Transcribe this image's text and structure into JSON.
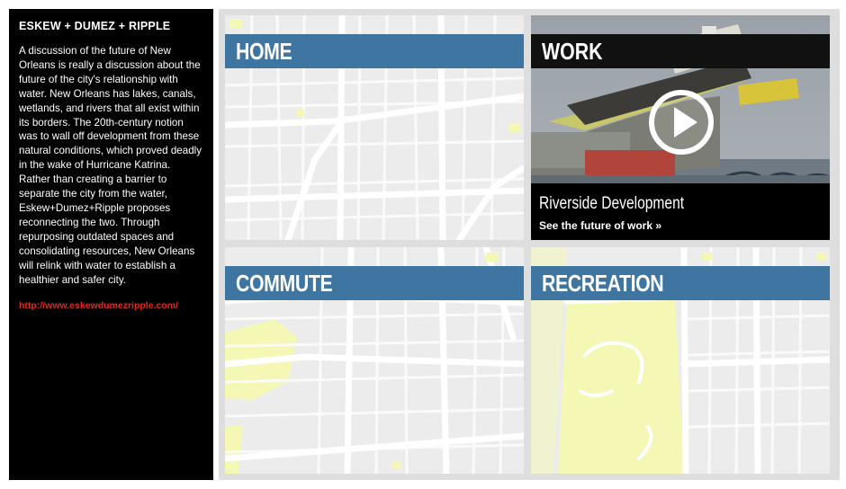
{
  "sidebar": {
    "title": "ESKEW + DUMEZ + RIPPLE",
    "description": "A discussion of the future of New Orleans is really a discussion about the future of the city's relationship with water. New Orleans has lakes, canals, wetlands, and rivers that all exist within its borders. The 20th-century notion was to wall off development from these natural conditions, which proved deadly in the wake of Hurricane Katrina. Rather than creating a barrier to separate the city from the water, Eskew+Dumez+Ripple proposes reconnecting the two. Through repurposing outdated spaces and consolidating resources, New Orleans will relink with water to establish a healthier and safer city.",
    "link": "http://www.eskewdumezripple.com/"
  },
  "tiles": {
    "home": {
      "label": "HOME"
    },
    "work": {
      "label": "WORK",
      "caption": "Riverside Development",
      "cta": "See the future of work »"
    },
    "commute": {
      "label": "COMMUTE"
    },
    "recreation": {
      "label": "RECREATION"
    }
  },
  "colors": {
    "banner": "#3f76a1",
    "map_bg": "#ececec",
    "street": "#ffffff",
    "park": "#f4f8b4",
    "link_red": "#e0281c"
  },
  "icons": {
    "play": "play-icon"
  }
}
